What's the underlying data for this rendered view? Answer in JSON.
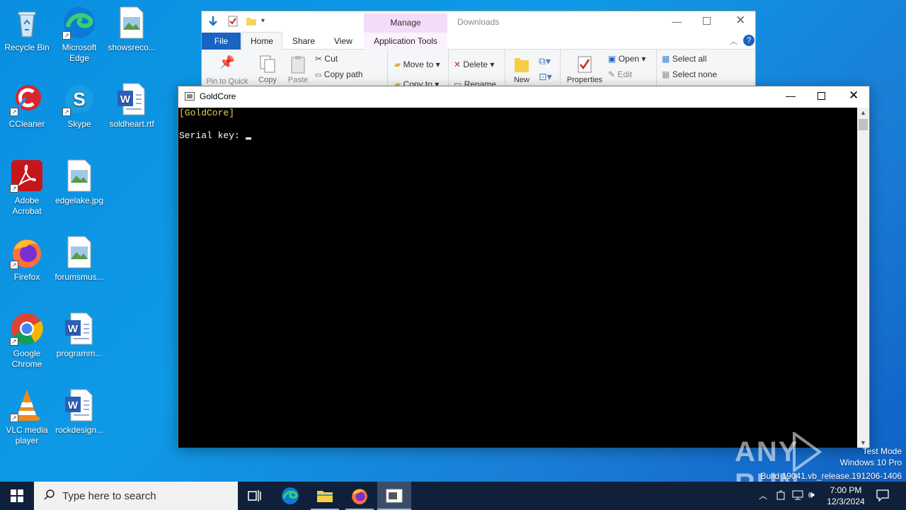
{
  "desktop_icons": [
    {
      "name": "Recycle Bin"
    },
    {
      "name": "Microsoft Edge"
    },
    {
      "name": "showsreco..."
    },
    {
      "name": "CCleaner"
    },
    {
      "name": "Skype"
    },
    {
      "name": "soldheart.rtf"
    },
    {
      "name": "Adobe Acrobat"
    },
    {
      "name": "edgelake.jpg"
    },
    {
      "name": "Firefox"
    },
    {
      "name": "forumsmus..."
    },
    {
      "name": "Google Chrome"
    },
    {
      "name": "programm..."
    },
    {
      "name": "VLC media player"
    },
    {
      "name": "rockdesign..."
    }
  ],
  "explorer": {
    "title": "Downloads",
    "context_tab": "Manage",
    "tabs": [
      "File",
      "Home",
      "Share",
      "View",
      "Application Tools"
    ],
    "ribbon": {
      "pin": "Pin to Quick",
      "copy": "Copy",
      "paste": "Paste",
      "cut": "Cut",
      "copy_path": "Copy path",
      "move_to": "Move to",
      "copy_to": "Copy to",
      "delete": "Delete",
      "rename": "Rename",
      "new": "New",
      "properties": "Properties",
      "open": "Open",
      "edit": "Edit",
      "select_all": "Select all",
      "select_none": "Select none"
    }
  },
  "console": {
    "title": "GoldCore",
    "line1": "[GoldCore]",
    "line2": "Serial key: ",
    "colors": {
      "line1": "#e8d25a",
      "line2": "#ffffff"
    }
  },
  "taskbar": {
    "search_placeholder": "Type here to search",
    "time": "7:00 PM",
    "date": "12/3/2024"
  },
  "watermark": {
    "brand": "ANY RUN",
    "mode": "Test Mode",
    "os": "Windows 10 Pro",
    "build": "Build 19041.vb_release.191206-1406"
  }
}
